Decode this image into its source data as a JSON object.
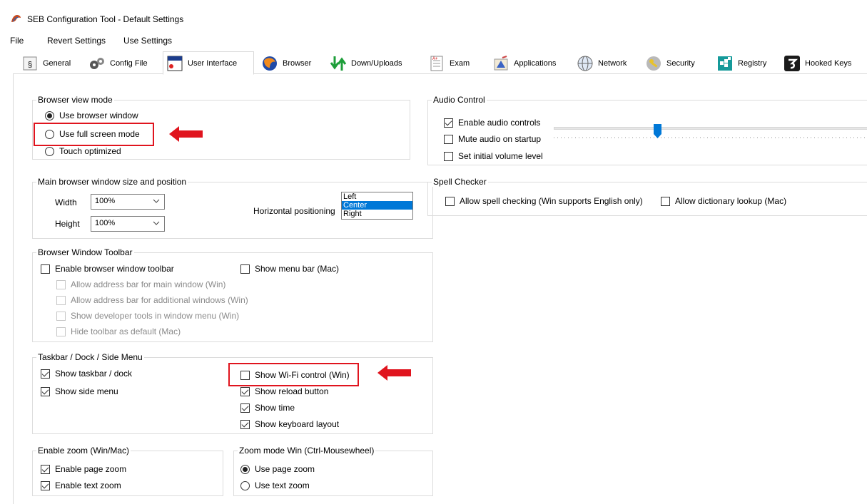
{
  "window": {
    "title": "SEB Configuration Tool - Default Settings"
  },
  "menu": [
    "File",
    "Revert Settings",
    "Use Settings"
  ],
  "tabs": [
    {
      "label": "General",
      "icon": "general-icon"
    },
    {
      "label": "Config File",
      "icon": "config-file-icon"
    },
    {
      "label": "User Interface",
      "icon": "user-interface-icon",
      "active": true
    },
    {
      "label": "Browser",
      "icon": "browser-icon"
    },
    {
      "label": "Down/Uploads",
      "icon": "down-uploads-icon"
    },
    {
      "label": "Exam",
      "icon": "exam-icon"
    },
    {
      "label": "Applications",
      "icon": "applications-icon"
    },
    {
      "label": "Network",
      "icon": "network-icon"
    },
    {
      "label": "Security",
      "icon": "security-icon"
    },
    {
      "label": "Registry",
      "icon": "registry-icon"
    },
    {
      "label": "Hooked Keys",
      "icon": "hooked-keys-icon"
    }
  ],
  "browser_view_mode": {
    "title": "Browser view mode",
    "options": [
      {
        "label": "Use browser window",
        "checked": true
      },
      {
        "label": "Use full screen mode",
        "checked": false
      },
      {
        "label": "Touch optimized",
        "checked": false
      }
    ]
  },
  "window_size": {
    "title": "Main browser window size and position",
    "width_label": "Width",
    "width_value": "100%",
    "height_label": "Height",
    "height_value": "100%",
    "hpos_label": "Horizontal positioning",
    "hpos_options": [
      "Left",
      "Center",
      "Right"
    ],
    "hpos_selected": "Center"
  },
  "toolbar": {
    "title": "Browser Window Toolbar",
    "enable": {
      "label": "Enable browser window toolbar",
      "checked": false
    },
    "menu_bar": {
      "label": "Show menu bar (Mac)",
      "checked": false
    },
    "sub": [
      {
        "label": "Allow address bar for main window (Win)",
        "checked": false
      },
      {
        "label": "Allow address bar for additional windows (Win)",
        "checked": false
      },
      {
        "label": "Show developer tools in window menu (Win)",
        "checked": false
      },
      {
        "label": "Hide toolbar as default (Mac)",
        "checked": false
      }
    ]
  },
  "taskbar": {
    "title": "Taskbar / Dock / Side Menu",
    "left": [
      {
        "label": "Show taskbar / dock",
        "checked": true
      },
      {
        "label": "Show side menu",
        "checked": true
      }
    ],
    "right": [
      {
        "label": "Show Wi-Fi control (Win)",
        "checked": false
      },
      {
        "label": "Show reload button",
        "checked": true
      },
      {
        "label": "Show time",
        "checked": true
      },
      {
        "label": "Show keyboard layout",
        "checked": true
      }
    ]
  },
  "zoom": {
    "title": "Enable zoom (Win/Mac)",
    "options": [
      {
        "label": "Enable page zoom",
        "checked": true
      },
      {
        "label": "Enable text zoom",
        "checked": true
      }
    ]
  },
  "zoom_mode": {
    "title": "Zoom mode Win (Ctrl-Mousewheel)",
    "options": [
      {
        "label": "Use page zoom",
        "checked": true
      },
      {
        "label": "Use text zoom",
        "checked": false
      }
    ]
  },
  "audio": {
    "title": "Audio Control",
    "options": [
      {
        "label": "Enable audio controls",
        "checked": true
      },
      {
        "label": "Mute audio on startup",
        "checked": false
      },
      {
        "label": "Set initial volume level",
        "checked": false
      }
    ],
    "volume_fraction": 0.33
  },
  "spell": {
    "title": "Spell Checker",
    "options": [
      {
        "label": "Allow spell checking (Win supports English only)",
        "checked": false
      },
      {
        "label": "Allow dictionary lookup (Mac)",
        "checked": false
      }
    ]
  },
  "colors": {
    "highlight": "#e0141e",
    "selection": "#0078d7"
  }
}
